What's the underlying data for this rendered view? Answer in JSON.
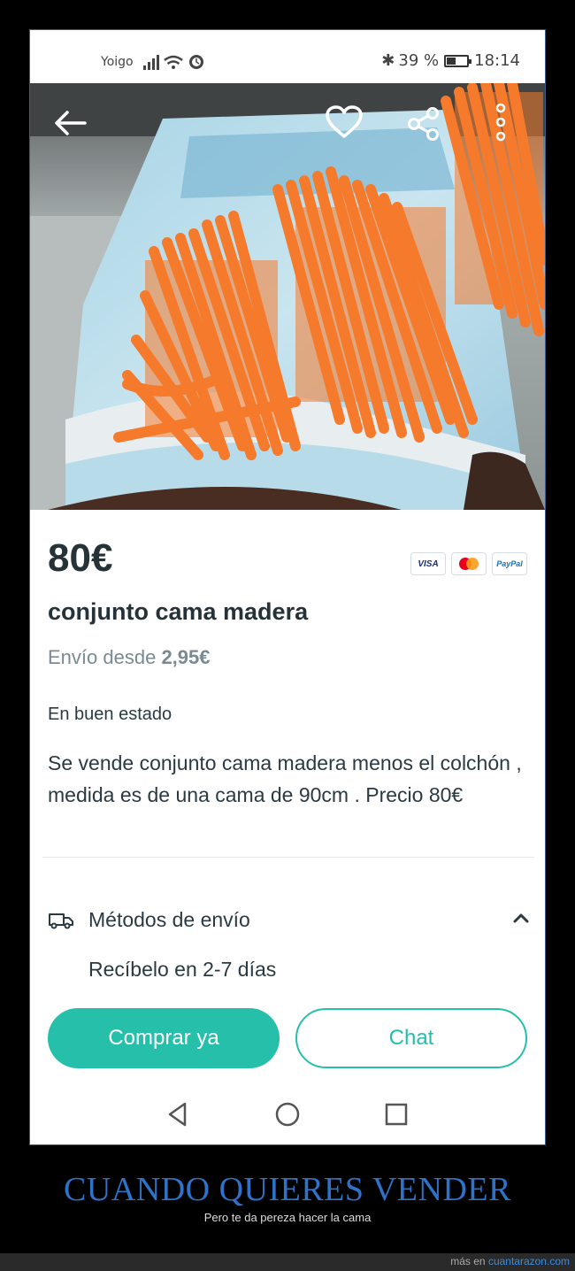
{
  "status_bar": {
    "carrier": "Yoigo",
    "battery": "39 %",
    "time": "18:14"
  },
  "listing": {
    "price": "80€",
    "payment_methods": [
      "VISA",
      "mastercard",
      "PayPal"
    ],
    "title": "conjunto cama madera",
    "shipping_prefix": "Envío desde",
    "shipping_price": "2,95€",
    "condition": "En buen estado",
    "description": "Se vende conjunto cama madera menos el colchón , medida es de una cama de 90cm . Precio 80€"
  },
  "shipping_methods": {
    "label": "Métodos de envío",
    "detail": "Recíbelo en 2-7 días"
  },
  "actions": {
    "buy_label": "Comprar ya",
    "chat_label": "Chat"
  },
  "caption": {
    "title": "CUANDO QUIERES VENDER",
    "subtitle": "Pero te da pereza hacer la cama"
  },
  "footer": {
    "prefix": "más en",
    "site": "cuantarazon.com"
  },
  "colors": {
    "accent": "#26bfa9",
    "scribble": "#f57a2c",
    "caption": "#2e73c7"
  },
  "icons": [
    "back-arrow-icon",
    "heart-icon",
    "share-icon",
    "more-vert-icon",
    "truck-icon",
    "chevron-up-icon",
    "nav-back-icon",
    "nav-home-icon",
    "nav-recents-icon"
  ]
}
